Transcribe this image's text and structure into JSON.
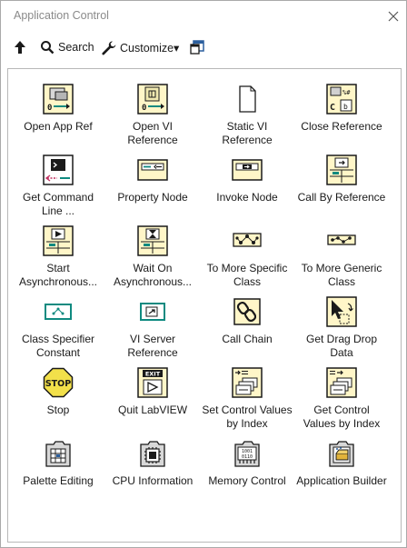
{
  "window": {
    "title": "Application Control"
  },
  "toolbar": {
    "search_label": "Search",
    "customize_label": "Customize▾"
  },
  "palette": {
    "items": [
      {
        "label": "Open App Ref",
        "icon": "open-app-ref-icon"
      },
      {
        "label": "Open VI Reference",
        "icon": "open-vi-reference-icon"
      },
      {
        "label": "Static VI Reference",
        "icon": "static-vi-reference-icon"
      },
      {
        "label": "Close Reference",
        "icon": "close-reference-icon"
      },
      {
        "label": "Get Command Line ...",
        "icon": "get-command-line-icon"
      },
      {
        "label": "Property Node",
        "icon": "property-node-icon"
      },
      {
        "label": "Invoke Node",
        "icon": "invoke-node-icon"
      },
      {
        "label": "Call By Reference",
        "icon": "call-by-reference-icon"
      },
      {
        "label": "Start Asynchronous...",
        "icon": "start-asynchronous-icon"
      },
      {
        "label": "Wait On Asynchronous...",
        "icon": "wait-on-asynchronous-icon"
      },
      {
        "label": "To More Specific Class",
        "icon": "to-more-specific-class-icon"
      },
      {
        "label": "To More Generic Class",
        "icon": "to-more-generic-class-icon"
      },
      {
        "label": "Class Specifier Constant",
        "icon": "class-specifier-constant-icon"
      },
      {
        "label": "VI Server Reference",
        "icon": "vi-server-reference-icon"
      },
      {
        "label": "Call Chain",
        "icon": "call-chain-icon"
      },
      {
        "label": "Get Drag Drop Data",
        "icon": "get-drag-drop-data-icon"
      },
      {
        "label": "Stop",
        "icon": "stop-icon"
      },
      {
        "label": "Quit LabVIEW",
        "icon": "quit-labview-icon"
      },
      {
        "label": "Set Control Values by Index",
        "icon": "set-control-values-icon"
      },
      {
        "label": "Get Control Values by Index",
        "icon": "get-control-values-icon"
      },
      {
        "label": "Palette Editing",
        "icon": "palette-editing-icon"
      },
      {
        "label": "CPU Information",
        "icon": "cpu-information-icon"
      },
      {
        "label": "Memory Control",
        "icon": "memory-control-icon"
      },
      {
        "label": "Application Builder",
        "icon": "application-builder-icon"
      }
    ]
  },
  "colors": {
    "vi_icon_fill": "#fff6c8",
    "ref_wire_teal": "#0f8a80",
    "stop_yellow": "#f2e04a"
  }
}
